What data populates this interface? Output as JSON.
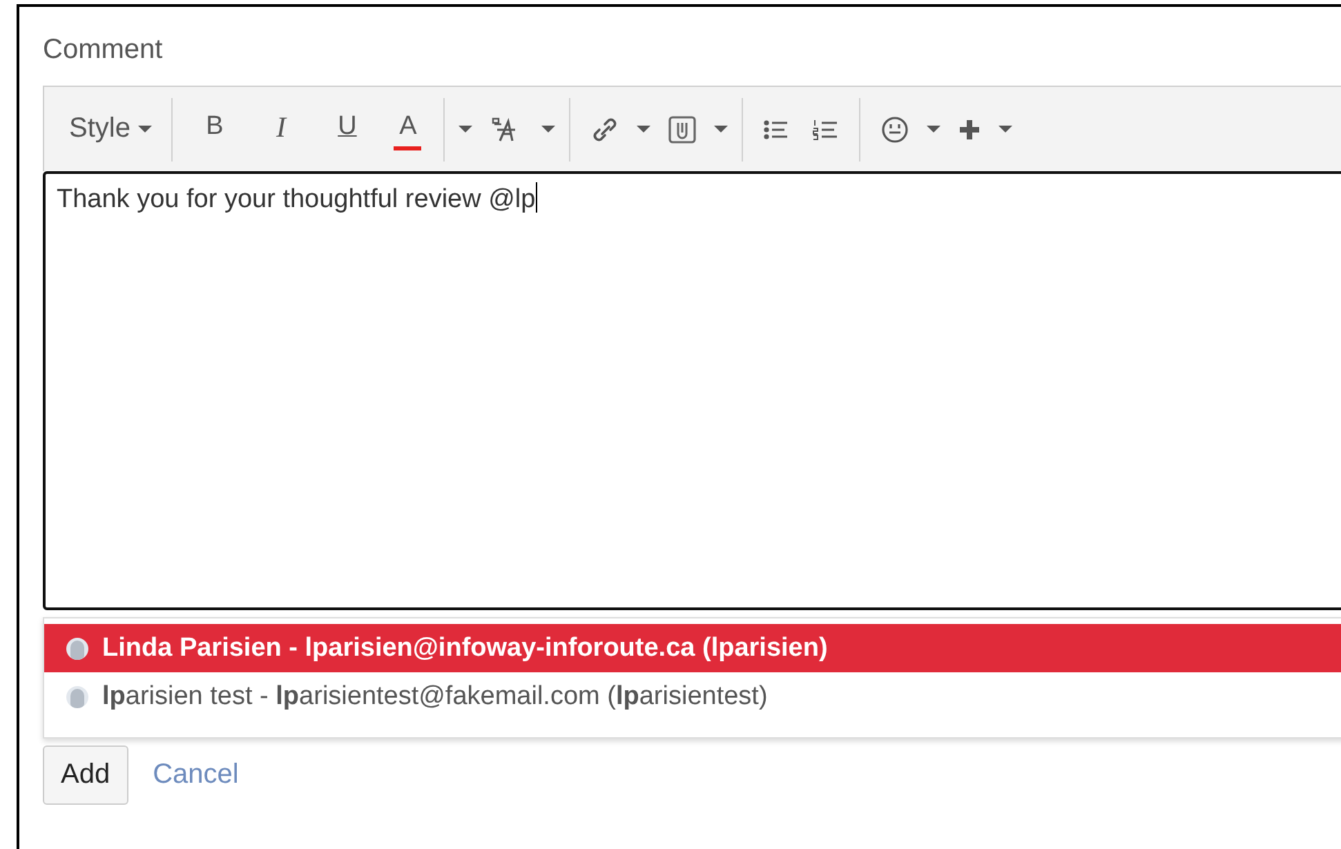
{
  "comment_label": "Comment",
  "toolbar": [
    {
      "kind": "dropdown",
      "label": "Style"
    },
    {
      "kind": "separator"
    },
    {
      "kind": "text",
      "label": "B"
    },
    {
      "kind": "text",
      "label": "I"
    },
    {
      "kind": "text",
      "label": "U"
    },
    {
      "kind": "text",
      "label": "A",
      "color": "#e8201e"
    },
    {
      "kind": "separator"
    },
    {
      "kind": "caret"
    },
    {
      "kind": "icon"
    },
    {
      "kind": "caret"
    },
    {
      "kind": "separator"
    },
    {
      "kind": "icon"
    },
    {
      "kind": "caret"
    },
    {
      "kind": "icon"
    },
    {
      "kind": "caret"
    },
    {
      "kind": "separator"
    },
    {
      "kind": "icon"
    },
    {
      "kind": "icon"
    },
    {
      "kind": "separator"
    },
    {
      "kind": "icon"
    },
    {
      "kind": "caret"
    },
    {
      "kind": "icon"
    },
    {
      "kind": "caret"
    }
  ],
  "editor": {
    "value": "Thank you for your thoughtful review @lp"
  },
  "suggestions": [
    {
      "text": "Linda Parisien - lparisien@infoway-inforoute.ca (lparisien)",
      "selected": true
    },
    {
      "text": "**lp**arisien test - **lp**arisientest@fakemail.com (**lp**arisientest)",
      "selected": false
    }
  ],
  "buttons": [
    {
      "kind": "button",
      "label": "Add"
    },
    {
      "kind": "link",
      "label": "Cancel"
    }
  ]
}
